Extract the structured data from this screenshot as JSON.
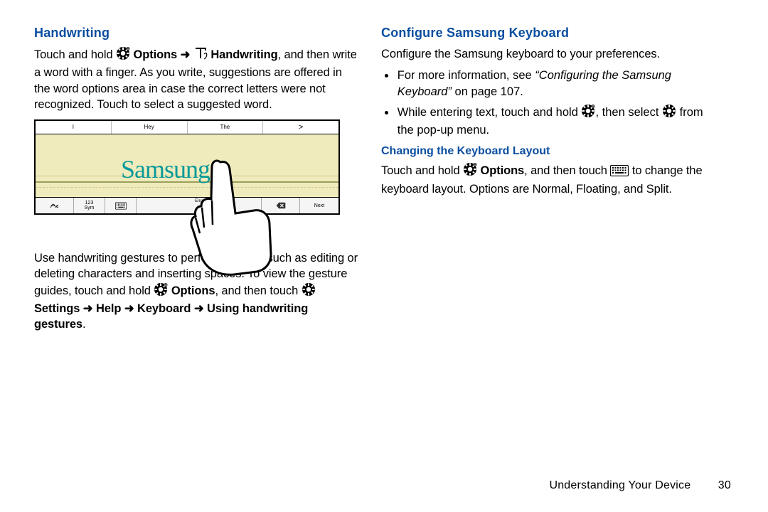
{
  "left": {
    "heading": "Handwriting",
    "p1_a": "Touch and hold ",
    "p1_options": "Options",
    "p1_arrow1": " ➜ ",
    "p1_handwriting": "Handwriting",
    "p1_b": ", and then write a word with a finger. As you write, suggestions are offered in the word options area in case the correct letters were not recognized. Touch to select a suggested word.",
    "figure": {
      "suggestions": [
        "I",
        "Hey",
        "The",
        ">"
      ],
      "handwritten": "Samsung",
      "bottom": {
        "mode_label": "123\nSym",
        "space_lang": "Eng",
        "del_icon": "backspace",
        "next_label": "Next"
      }
    },
    "p2_a": "Use handwriting gestures to perform actions, such as editing or deleting characters and inserting spaces. To view the gesture guides, touch and hold ",
    "p2_options": "Options",
    "p2_b": ", and then touch ",
    "p2_path": "Settings ➜ Help ➜ Keyboard ➜ Using handwriting gestures",
    "p2_c": "."
  },
  "right": {
    "heading1": "Configure Samsung Keyboard",
    "p1": "Configure the Samsung keyboard to your preferences.",
    "bullet1_a": "For more information, see ",
    "bullet1_ref": "“Configuring the Samsung Keyboard”",
    "bullet1_b": " on page 107.",
    "bullet2_a": "While entering text, touch and hold ",
    "bullet2_b": ", then select ",
    "bullet2_c": " from the pop-up menu.",
    "heading2": "Changing the Keyboard Layout",
    "p2_a": "Touch and hold ",
    "p2_options": "Options",
    "p2_b": ", and then touch ",
    "p2_c": " to change the keyboard layout. Options are Normal, Floating, and Split."
  },
  "footer": {
    "section": "Understanding Your Device",
    "page": "30"
  }
}
